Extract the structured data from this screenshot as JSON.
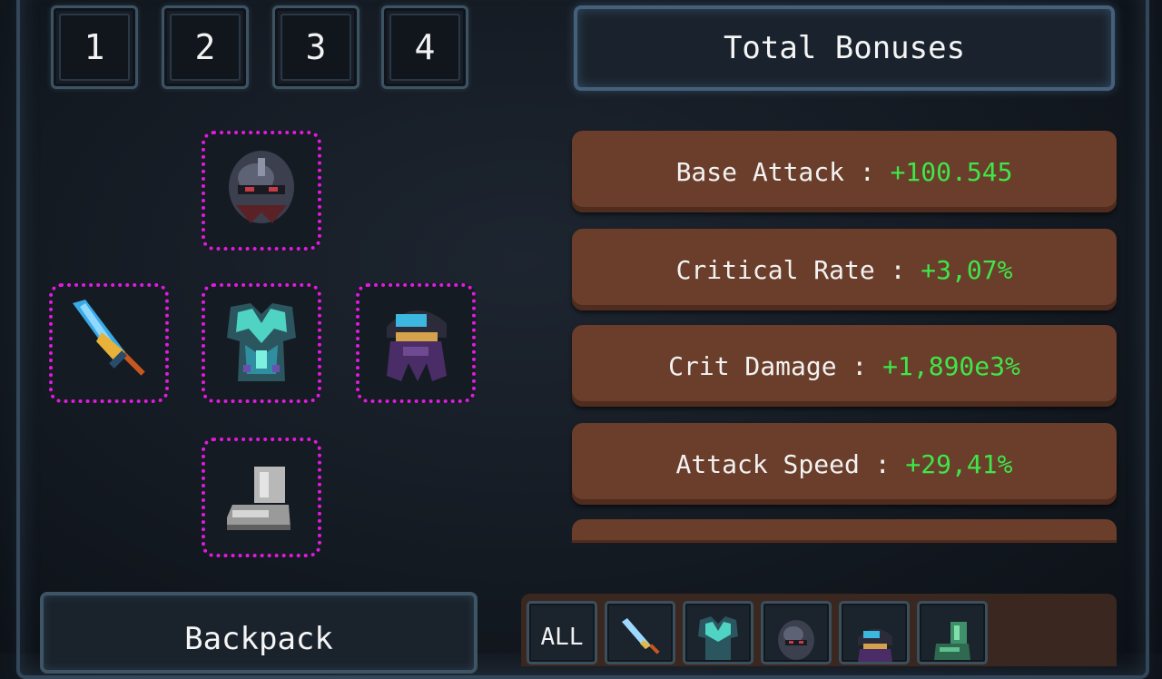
{
  "loadout_tabs": [
    "1",
    "2",
    "3",
    "4"
  ],
  "bonuses_panel": {
    "title": "Total Bonuses",
    "stats": [
      {
        "label": "Base Attack : ",
        "value": "+100.545"
      },
      {
        "label": "Critical Rate : ",
        "value": "+3,07%"
      },
      {
        "label": "Crit Damage : ",
        "value": "+1,890e3%"
      },
      {
        "label": "Attack Speed : ",
        "value": "+29,41%"
      }
    ]
  },
  "equipment_slots": [
    {
      "slot": "helmet",
      "icon": "dark-helmet-icon"
    },
    {
      "slot": "weapon",
      "icon": "blue-sword-icon"
    },
    {
      "slot": "armor",
      "icon": "crystal-chestplate-icon"
    },
    {
      "slot": "accessory",
      "icon": "shadow-cloak-icon"
    },
    {
      "slot": "boots",
      "icon": "silver-boots-icon"
    }
  ],
  "backpack": {
    "label": "Backpack"
  },
  "filters": {
    "all_label": "ALL",
    "icons": [
      "sword-filter-icon",
      "chestplate-filter-icon",
      "helmet-filter-icon",
      "accessory-filter-icon",
      "boots-filter-icon"
    ]
  },
  "colors": {
    "slot_border": "#e21adf",
    "stat_row_bg": "#6a3e2a",
    "stat_value": "#3fe64a"
  }
}
